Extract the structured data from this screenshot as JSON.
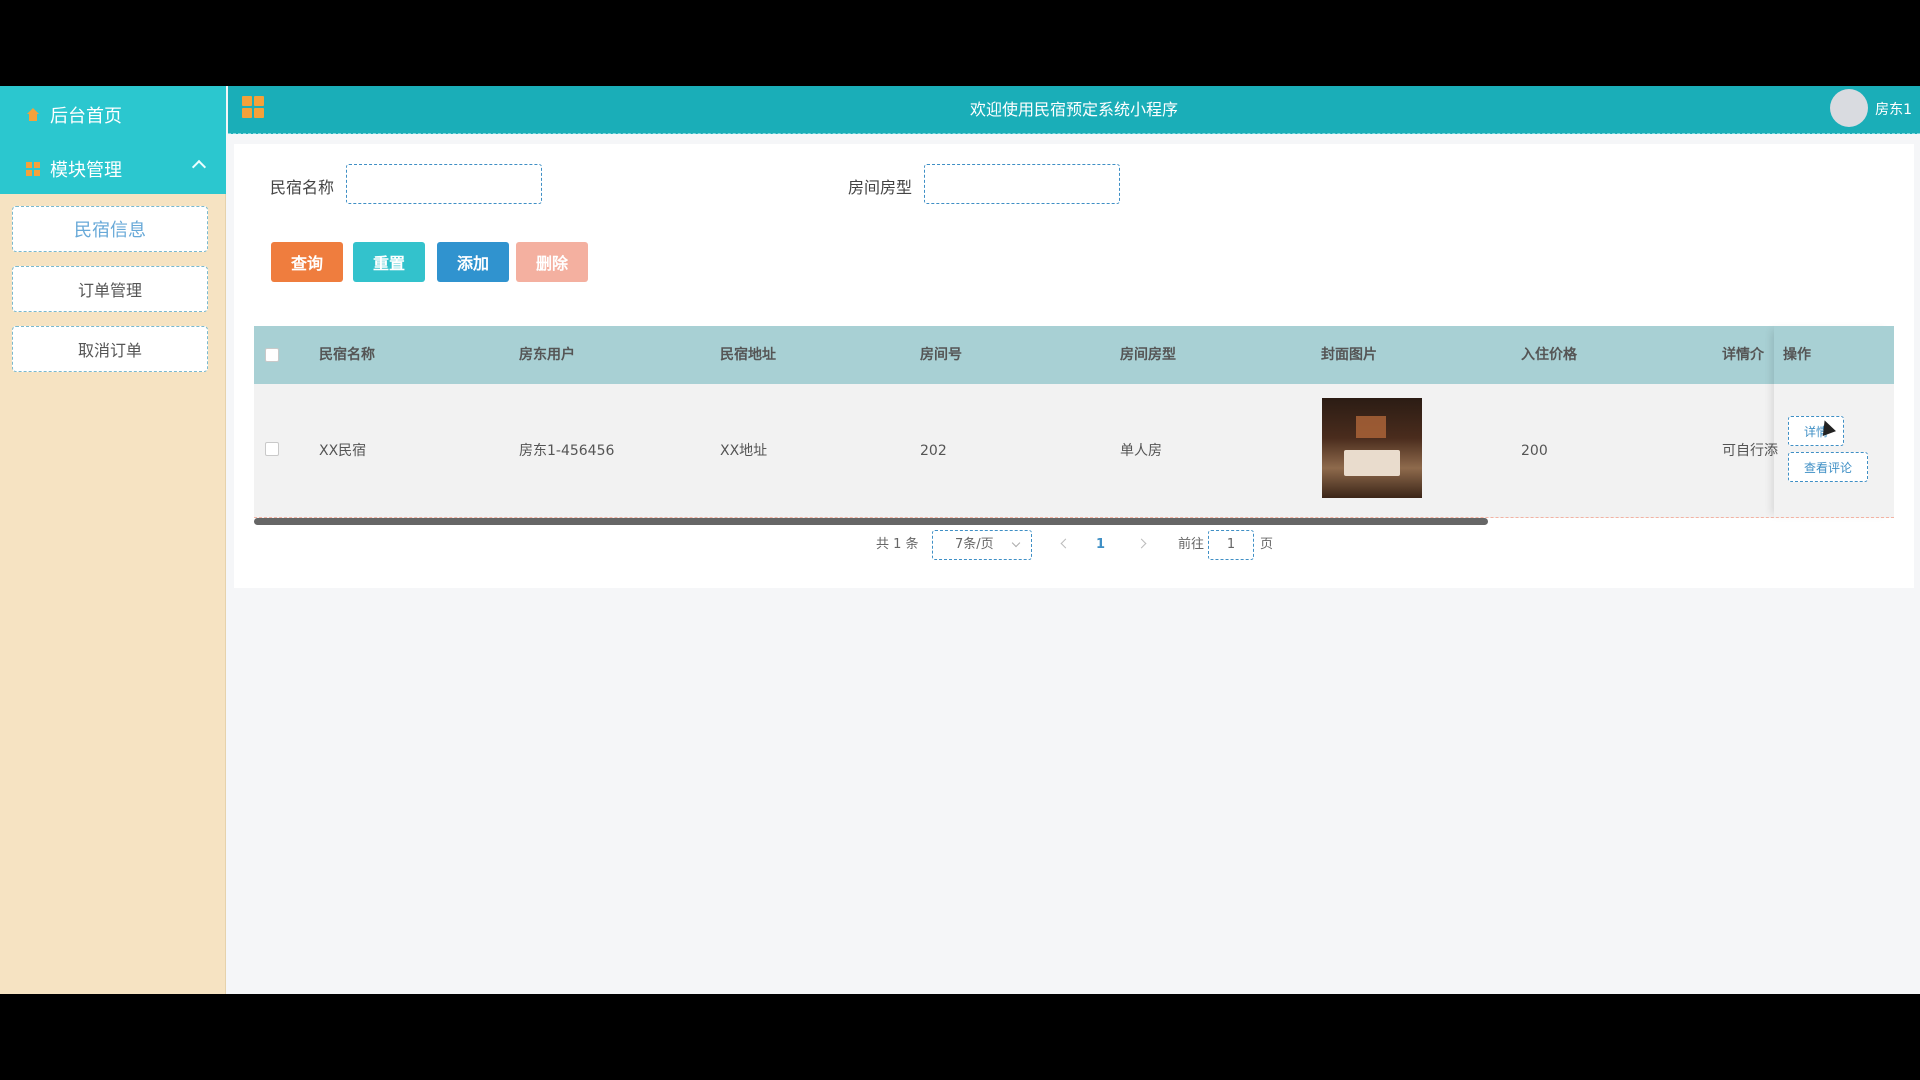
{
  "header": {
    "title": "欢迎使用民宿预定系统小程序",
    "user": "房东1"
  },
  "sidebar": {
    "home_label": "后台首页",
    "module_label": "模块管理",
    "items": [
      {
        "label": "民宿信息"
      },
      {
        "label": "订单管理"
      },
      {
        "label": "取消订单"
      }
    ]
  },
  "search": {
    "name_label": "民宿名称",
    "type_label": "房间房型",
    "name_value": "",
    "type_value": ""
  },
  "buttons": {
    "query": "查询",
    "reset": "重置",
    "add": "添加",
    "delete": "删除"
  },
  "table": {
    "headers": [
      "民宿名称",
      "房东用户",
      "民宿地址",
      "房间号",
      "房间房型",
      "封面图片",
      "入住价格",
      "详情介绍",
      "操作"
    ],
    "rows": [
      {
        "name": "XX民宿",
        "owner": "房东1-456456",
        "address": "XX地址",
        "room_no": "202",
        "room_type": "单人房",
        "price": "200",
        "detail": "可自行添",
        "ops": [
          "详情",
          "查看评论"
        ]
      }
    ]
  },
  "pagination": {
    "total": "共 1 条",
    "page_size": "7条/页",
    "current": "1",
    "goto_label": "前往",
    "goto_value": "1",
    "page_unit": "页"
  },
  "colors": {
    "accent": "#1aaeb8",
    "sidebar_bg": "#f6e3c2",
    "link": "#3f8fc5"
  }
}
